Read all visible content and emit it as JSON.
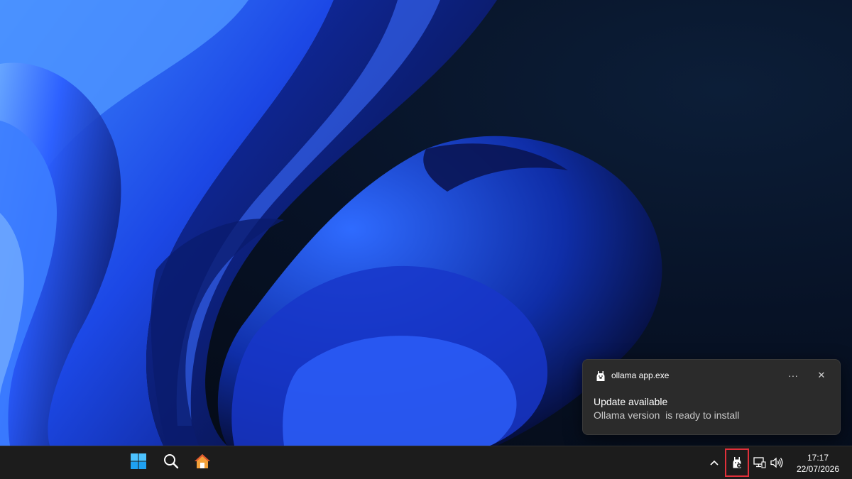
{
  "desktop": {
    "wallpaper": "windows-11-bloom-dark",
    "accent_color": "#1f5cff"
  },
  "notification": {
    "app_name": "ollama app.exe",
    "app_icon": "ollama-llama-icon",
    "more_label": "···",
    "close_label": "✕",
    "title": "Update available",
    "body": "Ollama version  is ready to install"
  },
  "taskbar": {
    "pinned": [
      {
        "name": "start-button",
        "icon": "windows-logo-icon"
      },
      {
        "name": "search-button",
        "icon": "search-icon"
      },
      {
        "name": "home-button",
        "icon": "home-icon"
      }
    ],
    "tray": {
      "overflow_label": "^",
      "icons": [
        "ollama-tray-icon",
        "network-icon",
        "volume-icon"
      ],
      "highlight_color": "#e0303a"
    },
    "clock": {
      "time": "17:17",
      "date": "22/07/2026"
    }
  }
}
